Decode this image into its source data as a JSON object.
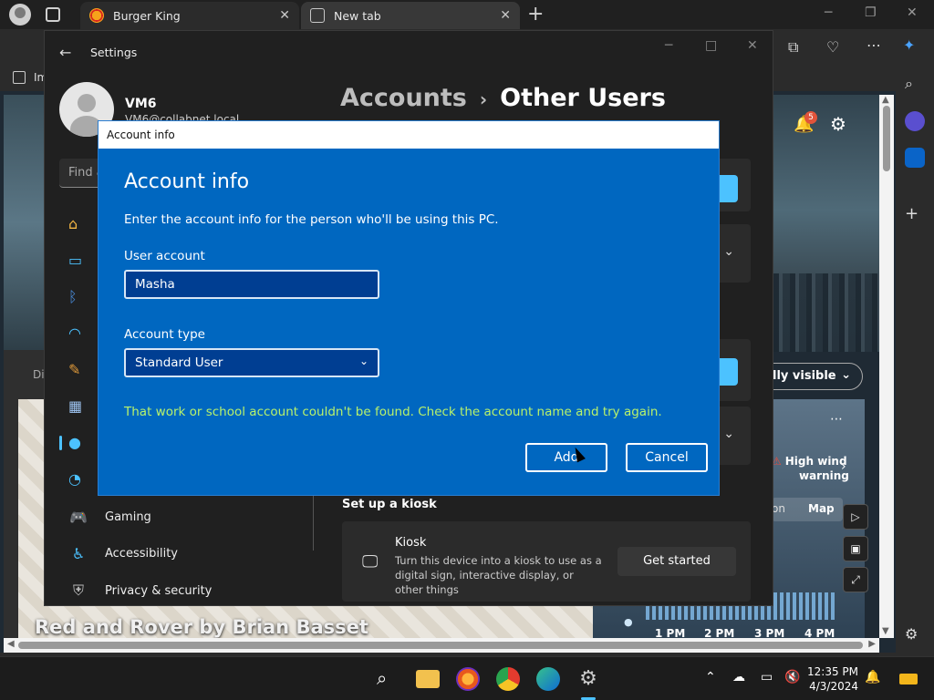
{
  "browser": {
    "tabs": [
      {
        "label": "Burger King"
      },
      {
        "label": "New tab"
      }
    ],
    "favorites_text": "Im"
  },
  "settings": {
    "window_title": "Settings",
    "user_name": "VM6",
    "user_email": "VM6@collabnet.local",
    "search_placeholder": "Find a",
    "breadcrumb": {
      "parent": "Accounts",
      "current": "Other Users"
    },
    "nav": [
      {
        "label": "Gaming",
        "icon": "gamepad-icon"
      },
      {
        "label": "Accessibility",
        "icon": "accessibility-icon"
      },
      {
        "label": "Privacy & security",
        "icon": "shield-icon"
      }
    ],
    "kiosk": {
      "section_label": "Set up a kiosk",
      "title": "Kiosk",
      "description": "Turn this device into a kiosk to use as a digital sign, interactive display, or other things",
      "button": "Get started"
    }
  },
  "dialog": {
    "titlebar": "Account info",
    "heading": "Account info",
    "intro": "Enter the account info for the person who'll be using this PC.",
    "user_account_label": "User account",
    "user_account_value": "Masha",
    "account_type_label": "Account type",
    "account_type_value": "Standard User",
    "error": "That work or school account couldn't be found. Check the account name and try again.",
    "add": "Add",
    "cancel": "Cancel"
  },
  "webpage": {
    "comic_caption": "Red and Rover by Brian Basset",
    "visibility_pill": "lly visible",
    "wind_warning_line1": "High wind",
    "wind_warning_line2": "warning",
    "map_tab_partial": "on",
    "map_tab": "Map",
    "times": [
      "1 PM",
      "2 PM",
      "3 PM",
      "4 PM"
    ],
    "notification_count": "5",
    "partial_tab_text": "Di"
  },
  "taskbar": {
    "time": "12:35 PM",
    "date": "4/3/2024"
  },
  "colors": {
    "dialog_bg": "#0067c0",
    "error_text": "#b8f26b",
    "accent": "#4cc2ff"
  }
}
